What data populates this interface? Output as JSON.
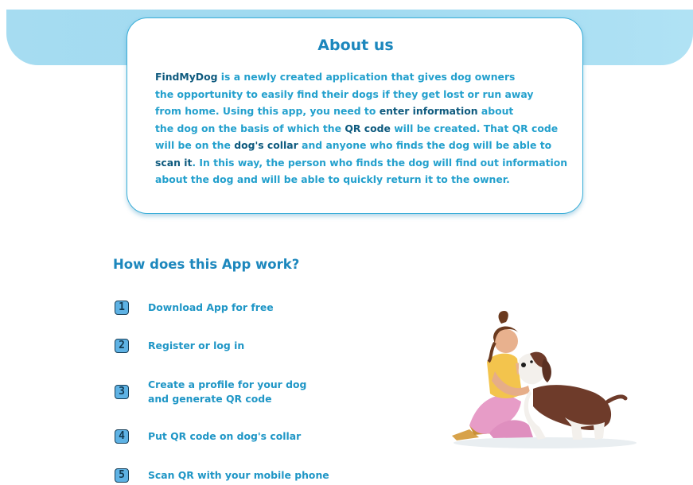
{
  "about": {
    "title": "About us",
    "lines": [
      [
        {
          "t": "FindMyDog",
          "b": true
        },
        {
          "t": " is a newly created application that gives dog owners",
          "b": false
        }
      ],
      [
        {
          "t": "the opportunity to easily find their dogs if they get lost or run away",
          "b": false
        }
      ],
      [
        {
          "t": "from home. Using this app, you need to ",
          "b": false
        },
        {
          "t": "enter information",
          "b": true
        },
        {
          "t": " about",
          "b": false
        }
      ],
      [
        {
          "t": "the dog on the basis of which the ",
          "b": false
        },
        {
          "t": "QR code",
          "b": true
        },
        {
          "t": " will be created. That QR code",
          "b": false
        }
      ],
      [
        {
          "t": "will be on the ",
          "b": false
        },
        {
          "t": "dog's collar",
          "b": true
        },
        {
          "t": " and anyone who finds the dog will be able to",
          "b": false
        }
      ],
      [
        {
          "t": "scan it",
          "b": true
        },
        {
          "t": ". In this way, the person who finds the dog will find out information",
          "b": false
        }
      ],
      [
        {
          "t": "about the dog and will be able to quickly return it to the owner.",
          "b": false
        }
      ]
    ]
  },
  "how": {
    "title": "How does this App work?",
    "steps": [
      {
        "num": "1",
        "label": "Download App for free"
      },
      {
        "num": "2",
        "label": "Register or log in"
      },
      {
        "num": "3",
        "label": "Create a profile for your dog\nand generate QR code"
      },
      {
        "num": "4",
        "label": "Put QR code on dog's collar"
      },
      {
        "num": "5",
        "label": "Scan QR with your mobile phone"
      }
    ]
  },
  "colors": {
    "accent": "#1c87bd",
    "text": "#23a0cd",
    "emphasis": "#0e5a7e",
    "band": "#a6dcf1"
  },
  "icons": {
    "step_badge": "digit-badge-icon",
    "illustration": "girl-petting-dog-illustration"
  }
}
